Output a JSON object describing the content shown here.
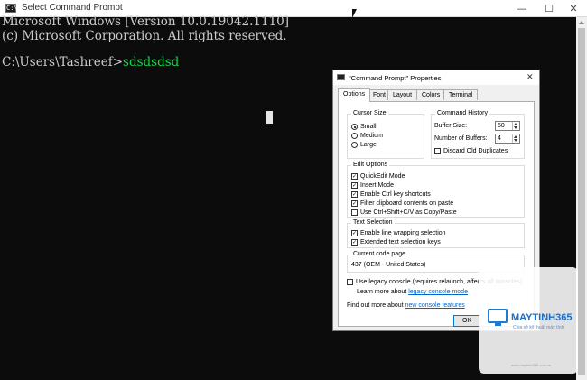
{
  "window": {
    "title": "Select Command Prompt",
    "icon_text": "C:\\",
    "minimize": "—",
    "maximize": "☐",
    "close": "✕"
  },
  "console": {
    "line1": "Microsoft Windows [Version 10.0.19042.1110]",
    "line2": "(c) Microsoft Corporation. All rights reserved.",
    "prompt": "C:\\Users\\Tashreef>",
    "typed": "sdsdsdsd"
  },
  "dialog": {
    "title": "\"Command Prompt\" Properties",
    "close": "✕",
    "tabs": [
      "Options",
      "Font",
      "Layout",
      "Colors",
      "Terminal"
    ],
    "cursor_size": {
      "title": "Cursor Size",
      "options": [
        "Small",
        "Medium",
        "Large"
      ],
      "selected": "Small"
    },
    "command_history": {
      "title": "Command History",
      "buffer_size_label": "Buffer Size:",
      "buffer_size": "50",
      "num_buffers_label": "Number of Buffers:",
      "num_buffers": "4",
      "discard_label": "Discard Old Duplicates"
    },
    "edit_options": {
      "title": "Edit Options",
      "items": [
        "QuickEdit Mode",
        "Insert Mode",
        "Enable Ctrl key shortcuts",
        "Filter clipboard contents on paste",
        "Use Ctrl+Shift+C/V as Copy/Paste"
      ],
      "checked": [
        true,
        true,
        true,
        true,
        false
      ]
    },
    "text_selection": {
      "title": "Text Selection",
      "items": [
        "Enable line wrapping selection",
        "Extended text selection keys"
      ],
      "checked": [
        true,
        true
      ]
    },
    "code_page": {
      "title": "Current code page",
      "value": "437   (OEM - United States)"
    },
    "legacy": {
      "label": "Use legacy console (requires relaunch, affects all consoles)",
      "learn_prefix": "Learn more about ",
      "learn_link": "legacy console mode"
    },
    "find_more_prefix": "Find out more about ",
    "find_more_link": "new console features",
    "ok_label": "OK"
  },
  "watermark": {
    "brand": "MAYTINH365",
    "sub": "Chia sẻ kỹ thuật máy tính",
    "url": "www.maytinh365.com.vn"
  },
  "colors": {
    "console_bg": "#0c0c0c",
    "console_text": "#cccccc",
    "typed_text": "#15d64f",
    "link": "#0066cc",
    "accent": "#0078d7"
  }
}
